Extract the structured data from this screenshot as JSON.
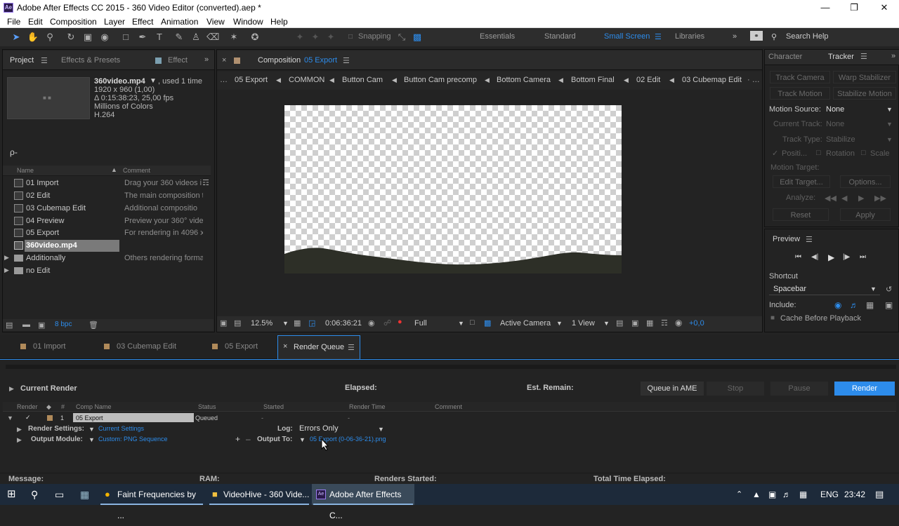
{
  "window": {
    "title": "Adobe After Effects CC 2015 - 360 Video Editor (converted).aep *",
    "app_badge": "Ae"
  },
  "menu": [
    "File",
    "Edit",
    "Composition",
    "Layer",
    "Effect",
    "Animation",
    "View",
    "Window",
    "Help"
  ],
  "toolbar": {
    "snapping_label": "Snapping",
    "workspaces": [
      "Essentials",
      "Standard",
      "Small Screen",
      "Libraries"
    ],
    "active_workspace": "Small Screen",
    "search_label": "Search Help"
  },
  "project_panel": {
    "tabs": [
      "Project",
      "Effects & Presets",
      "Effect"
    ],
    "asset": {
      "name": "360video.mp4",
      "used": ", used 1 time",
      "line1": "1920 x 960 (1,00)",
      "line2": "Δ 0:15:38:23, 25,00 fps",
      "line3": "Millions of Colors",
      "line4": "H.264"
    },
    "search_icon_label": "ρ-",
    "columns": [
      "Name",
      "Comment"
    ],
    "items": [
      {
        "name": "01 Import",
        "comment": "Drag your 360 videos i",
        "type": "comp"
      },
      {
        "name": "02 Edit",
        "comment": "The main composition t",
        "type": "comp"
      },
      {
        "name": "03 Cubemap Edit",
        "comment": "Additional compositio",
        "type": "comp"
      },
      {
        "name": "04 Preview",
        "comment": "Preview your 360° vide",
        "type": "comp"
      },
      {
        "name": "05 Export",
        "comment": "For rendering in 4096 x",
        "type": "comp"
      },
      {
        "name": "360video.mp4",
        "comment": "",
        "type": "footage"
      },
      {
        "name": "Additionally",
        "comment": "Others rendering forma",
        "type": "folder"
      },
      {
        "name": "no Edit",
        "comment": "",
        "type": "folder"
      }
    ],
    "bpc": "8 bpc"
  },
  "composition_panel": {
    "tab_prefix": "Composition",
    "tab_name": "05 Export",
    "breadcrumbs": [
      "05 Export",
      "COMMON",
      "Button Cam",
      "Button Cam precomp",
      "Bottom Camera",
      "Bottom Final",
      "02 Edit",
      "03 Cubemap Edit"
    ],
    "footer": {
      "zoom": "12.5%",
      "timecode": "0:06:36:21",
      "resolution": "Full",
      "camera": "Active Camera",
      "views": "1 View",
      "exposure": "+0,0"
    }
  },
  "tracker_panel": {
    "tabs": [
      "Character",
      "Tracker"
    ],
    "buttons": [
      "Track Camera",
      "Warp Stabilizer",
      "Track Motion",
      "Stabilize Motion"
    ],
    "motion_source_label": "Motion Source:",
    "motion_source_value": "None",
    "current_track_label": "Current Track:",
    "current_track_value": "None",
    "track_type_label": "Track Type:",
    "track_type_value": "Stabilize",
    "position_label": "Positi...",
    "rotation_label": "Rotation",
    "scale_label": "Scale",
    "motion_target_label": "Motion Target:",
    "edit_target": "Edit Target...",
    "options": "Options...",
    "analyze_label": "Analyze:",
    "reset": "Reset",
    "apply": "Apply"
  },
  "preview_panel": {
    "title": "Preview",
    "shortcut_label": "Shortcut",
    "shortcut_value": "Spacebar",
    "include_label": "Include:",
    "cache_label": "Cache Before Playback"
  },
  "bottom_tabs": [
    "01 Import",
    "03 Cubemap Edit",
    "05 Export",
    "Render Queue"
  ],
  "render_queue": {
    "current_render": "Current Render",
    "elapsed": "Elapsed:",
    "est_remain": "Est. Remain:",
    "queue_ame": "Queue in AME",
    "stop": "Stop",
    "pause": "Pause",
    "render": "Render",
    "columns": [
      "Render",
      "#",
      "Comp Name",
      "Status",
      "Started",
      "Render Time",
      "Comment"
    ],
    "item": {
      "num": "1",
      "comp": "05 Export",
      "status": "Queued",
      "started": "-",
      "render_time": "-"
    },
    "render_settings_label": "Render Settings:",
    "render_settings_value": "Current Settings",
    "log_label": "Log:",
    "log_value": "Errors Only",
    "output_module_label": "Output Module:",
    "output_module_value": "Custom: PNG Sequence",
    "output_to_label": "Output To:",
    "output_to_value": "05 Export (0-06-36-21).png",
    "message": "Message:",
    "ram": "RAM:",
    "renders_started": "Renders Started:",
    "total_time": "Total Time Elapsed:"
  },
  "taskbar": {
    "items": [
      "Faint Frequencies by ...",
      "VideoHive - 360 Vide...",
      "Adobe After Effects C..."
    ],
    "lang": "ENG",
    "time": "23:42"
  }
}
